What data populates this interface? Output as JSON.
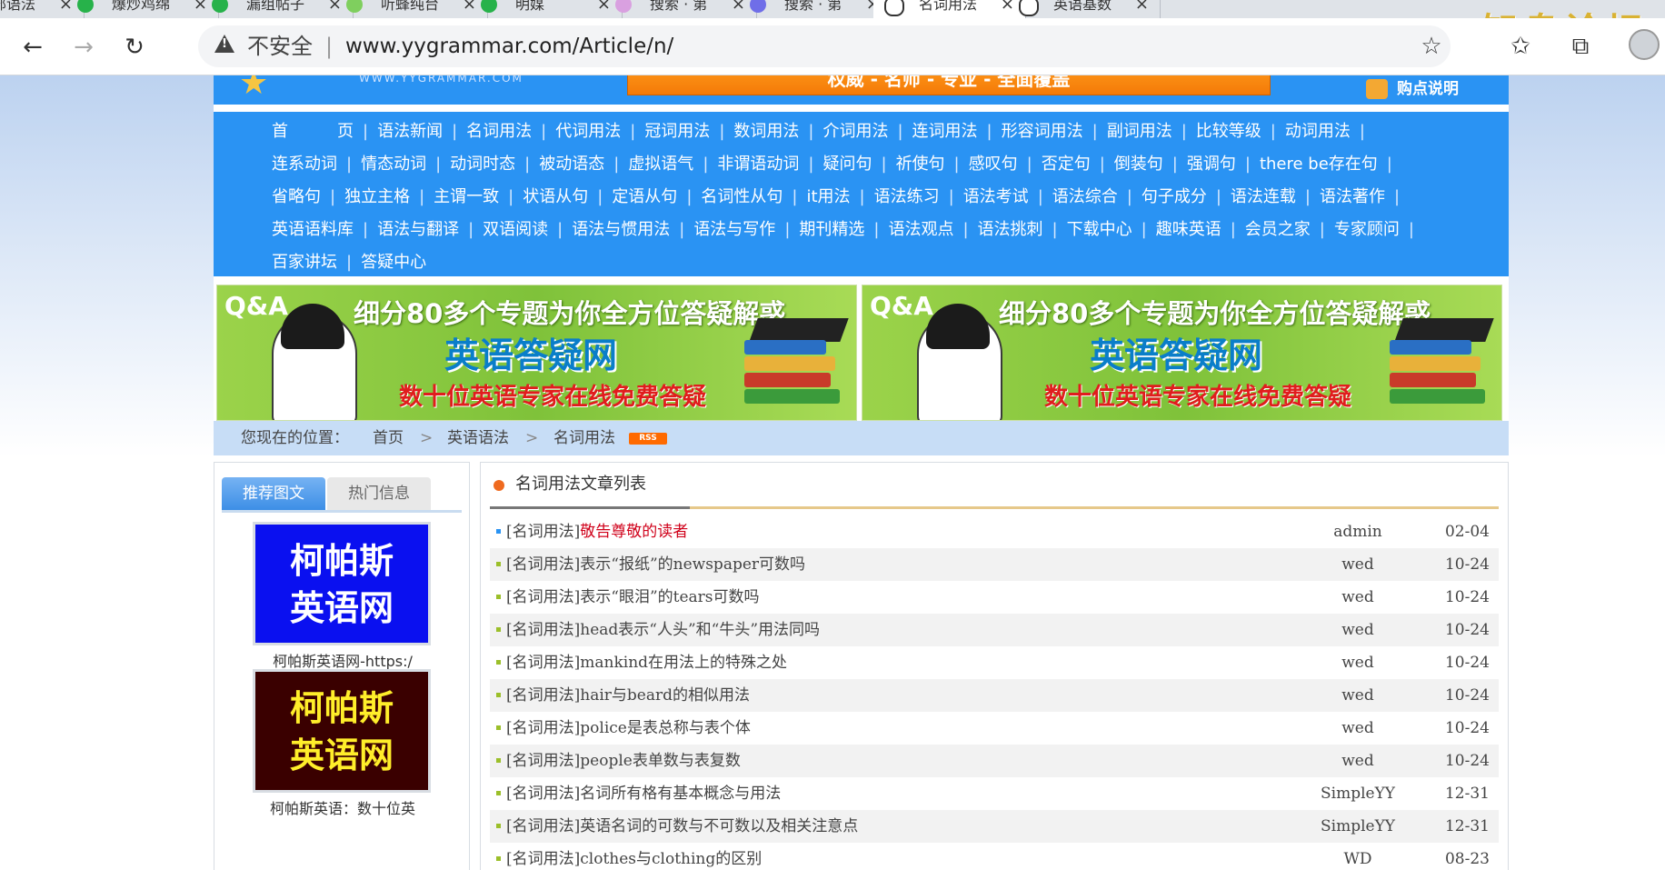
{
  "browser": {
    "tabs": [
      {
        "label": "玉部语法",
        "color": "#27b24a",
        "active": false
      },
      {
        "label": "爆炒鸡绵",
        "color": "#27b24a",
        "active": false
      },
      {
        "label": "漏组帖子",
        "color": "#27b24a",
        "active": false
      },
      {
        "label": "听蜂纯台",
        "color": "#7fcf5e",
        "active": false
      },
      {
        "label": "明媒",
        "color": "#27b24a",
        "active": false
      },
      {
        "label": "搜索 · 第",
        "color": "#d9a0e0",
        "active": false
      },
      {
        "label": "搜索 · 第",
        "color": "#6f6ee8",
        "active": false
      },
      {
        "label": "名词用法",
        "color": "#ffffff",
        "active": true
      },
      {
        "label": "英语基数",
        "color": "#ffffff",
        "active": false
      }
    ],
    "watermark": "知鸟论坛",
    "not_secure": "不安全",
    "url": "www.yygrammar.com/Article/n/"
  },
  "header": {
    "logo_url": "WWW.YYGRAMMAR.COM",
    "promo": "权威 - 名师 - 专业 - 全面覆盖",
    "buy": "购点说明"
  },
  "nav": [
    "首　　　页",
    "语法新闻",
    "名词用法",
    "代词用法",
    "冠词用法",
    "数词用法",
    "介词用法",
    "连词用法",
    "形容词用法",
    "副词用法",
    "比较等级",
    "动词用法",
    "连系动词",
    "情态动词",
    "动词时态",
    "被动语态",
    "虚拟语气",
    "非谓语动词",
    "疑问句",
    "祈使句",
    "感叹句",
    "否定句",
    "倒装句",
    "强调句",
    "there be存在句",
    "省略句",
    "独立主格",
    "主谓一致",
    "状语从句",
    "定语从句",
    "名词性从句",
    "it用法",
    "语法练习",
    "语法考试",
    "语法综合",
    "句子成分",
    "语法连载",
    "语法著作",
    "英语语料库",
    "语法与翻译",
    "双语阅读",
    "语法与惯用法",
    "语法与写作",
    "期刊精选",
    "语法观点",
    "语法挑刺",
    "下载中心",
    "趣味英语",
    "会员之家",
    "专家顾问",
    "百家讲坛",
    "答疑中心"
  ],
  "ad": {
    "qa": "Q&A",
    "line1": "细分80多个专题为你全方位答疑解惑",
    "line2": "英语答疑网",
    "line3": "数十位英语专家在线免费答疑"
  },
  "breadcrumb": {
    "label": "您现在的位置：",
    "items": [
      "首页",
      "英语语法",
      "名词用法"
    ],
    "sep": ">",
    "rss": "RSS"
  },
  "sidebar": {
    "tab_on": "推荐图文",
    "tab_off": "热门信息",
    "thumbs": [
      {
        "line1": "柯帕斯",
        "line2": "英语网",
        "bg": "#0a10f0",
        "fg": "#ffffff",
        "caption": "柯帕斯英语网-https:/"
      },
      {
        "line1": "柯帕斯",
        "line2": "英语网",
        "bg": "#3a0000",
        "fg": "#ffee2a",
        "caption": "柯帕斯英语：数十位英"
      }
    ]
  },
  "articles": {
    "title": "名词用法文章列表",
    "rows": [
      {
        "prefix": "[名词用法]",
        "title": "敬告尊敬的读者",
        "hot": true,
        "author": "admin",
        "date": "02-04"
      },
      {
        "prefix": "[名词用法]",
        "title": "表示“报纸”的newspaper可数吗",
        "hot": false,
        "author": "wed",
        "date": "10-24"
      },
      {
        "prefix": "[名词用法]",
        "title": "表示“眼泪”的tears可数吗",
        "hot": false,
        "author": "wed",
        "date": "10-24"
      },
      {
        "prefix": "[名词用法]",
        "title": "head表示“人头”和“牛头”用法同吗",
        "hot": false,
        "author": "wed",
        "date": "10-24"
      },
      {
        "prefix": "[名词用法]",
        "title": "mankind在用法上的特殊之处",
        "hot": false,
        "author": "wed",
        "date": "10-24"
      },
      {
        "prefix": "[名词用法]",
        "title": "hair与beard的相似用法",
        "hot": false,
        "author": "wed",
        "date": "10-24"
      },
      {
        "prefix": "[名词用法]",
        "title": "police是表总称与表个体",
        "hot": false,
        "author": "wed",
        "date": "10-24"
      },
      {
        "prefix": "[名词用法]",
        "title": "people表单数与表复数",
        "hot": false,
        "author": "wed",
        "date": "10-24"
      },
      {
        "prefix": "[名词用法]",
        "title": "名词所有格有基本概念与用法",
        "hot": false,
        "author": "SimpleYY",
        "date": "12-31"
      },
      {
        "prefix": "[名词用法]",
        "title": "英语名词的可数与不可数以及相关注意点",
        "hot": false,
        "author": "SimpleYY",
        "date": "12-31"
      },
      {
        "prefix": "[名词用法]",
        "title": "clothes与clothing的区别",
        "hot": false,
        "author": "WD",
        "date": "08-23"
      }
    ]
  }
}
